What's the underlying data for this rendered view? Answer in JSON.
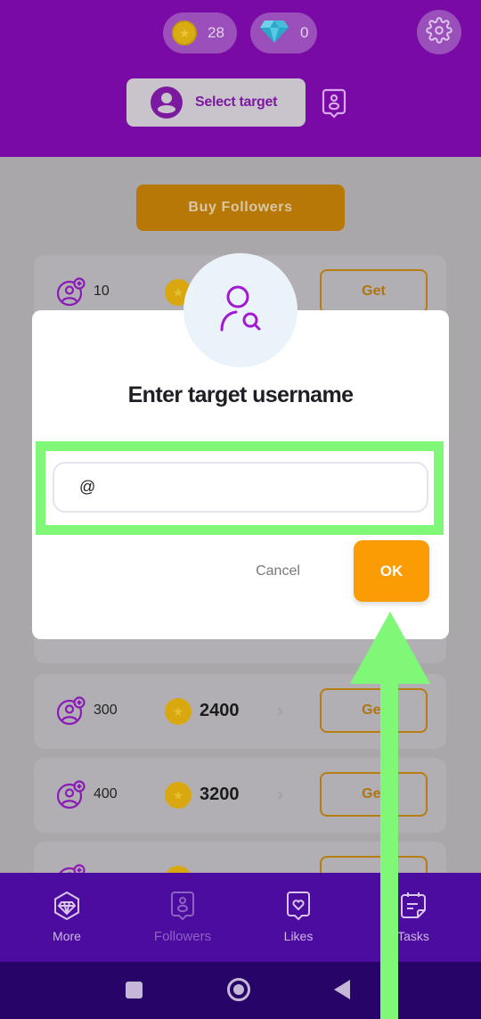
{
  "header": {
    "coins": "28",
    "gems": "0",
    "select_target_label": "Select target",
    "icons": [
      "coin-icon",
      "diamond-icon",
      "gear-icon",
      "user-circle-icon",
      "followers-badge-icon"
    ]
  },
  "main": {
    "buy_button_label": "Buy Followers",
    "packages": [
      {
        "followers": "10",
        "price": "",
        "button": "Get"
      },
      {
        "followers": "",
        "price": "",
        "button": ""
      },
      {
        "followers": "300",
        "price": "2400",
        "button": "Get"
      },
      {
        "followers": "400",
        "price": "3200",
        "button": "Get"
      },
      {
        "followers": "",
        "price": "",
        "button": ""
      }
    ]
  },
  "dialog": {
    "title": "Enter target username",
    "input_value": "@",
    "cancel_label": "Cancel",
    "ok_label": "OK",
    "icon": "user-search-icon"
  },
  "bottom_nav": {
    "items": [
      {
        "label": "More",
        "icon": "diamond-hexagon-icon",
        "active": false
      },
      {
        "label": "Followers",
        "icon": "followers-badge-icon",
        "active": true
      },
      {
        "label": "Likes",
        "icon": "heart-badge-icon",
        "active": false
      },
      {
        "label": "Tasks",
        "icon": "tasks-note-icon",
        "active": false
      }
    ]
  },
  "system_nav": {
    "buttons": [
      "recents",
      "home",
      "back"
    ]
  },
  "colors": {
    "brand_purple": "#7a0aa6",
    "nav_purple": "#4c0ca0",
    "accent_orange": "#fb9c05",
    "annotation_green": "#7ff777"
  }
}
